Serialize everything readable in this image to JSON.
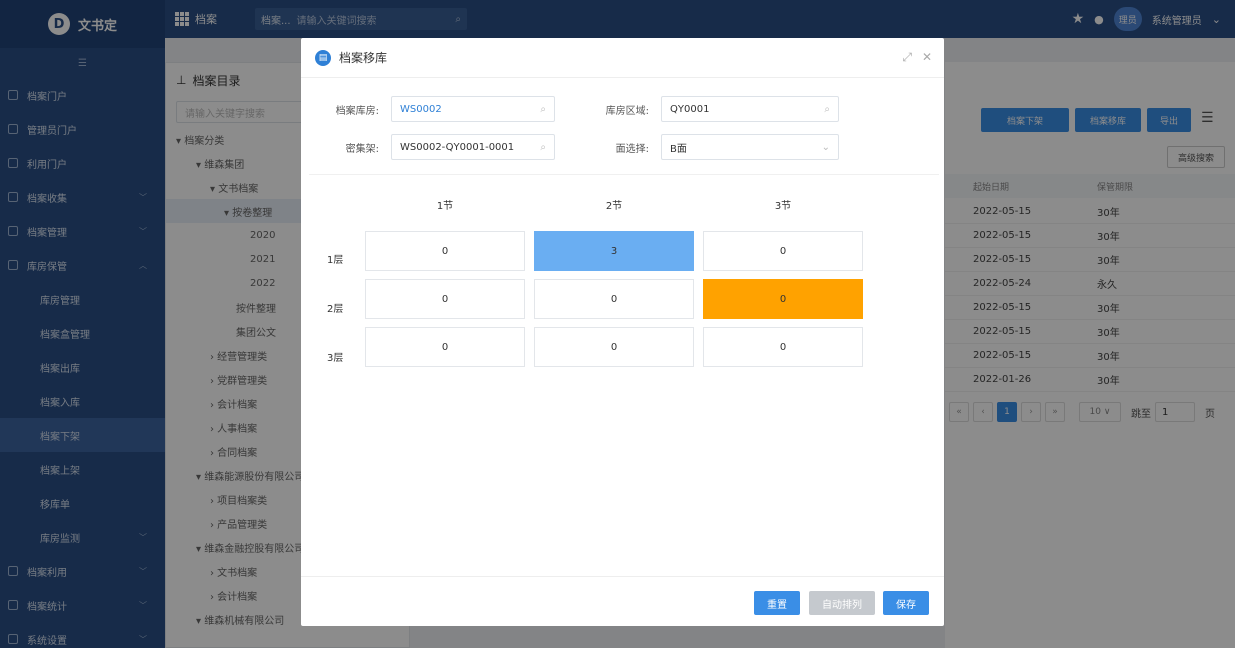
{
  "app": {
    "brand": "文书定",
    "colors": {
      "primary": "#2a4f86",
      "accent": "#3a8ee6",
      "cell_highlight_blue": "#6aaef2",
      "cell_highlight_orange": "#ffa200"
    }
  },
  "topbar": {
    "module": "档案",
    "search_scope": "档案...",
    "search_placeholder": "请输入关键词搜索",
    "username": "系统管理员",
    "avatar_text": "理员"
  },
  "sidebar": {
    "items": [
      {
        "label": "档案门户",
        "icon": "portal-icon",
        "indent": false,
        "chevron": ""
      },
      {
        "label": "管理员门户",
        "icon": "admin-portal-icon",
        "indent": false,
        "chevron": ""
      },
      {
        "label": "利用门户",
        "icon": "use-portal-icon",
        "indent": false,
        "chevron": ""
      },
      {
        "label": "档案收集",
        "icon": "collect-icon",
        "indent": false,
        "chevron": "﹀"
      },
      {
        "label": "档案管理",
        "icon": "manage-icon",
        "indent": false,
        "chevron": "﹀"
      },
      {
        "label": "库房保管",
        "icon": "storage-icon",
        "indent": false,
        "chevron": "︿"
      },
      {
        "label": "库房管理",
        "icon": "",
        "indent": true,
        "chevron": ""
      },
      {
        "label": "档案盒管理",
        "icon": "",
        "indent": true,
        "chevron": ""
      },
      {
        "label": "档案出库",
        "icon": "",
        "indent": true,
        "chevron": ""
      },
      {
        "label": "档案入库",
        "icon": "",
        "indent": true,
        "chevron": ""
      },
      {
        "label": "档案下架",
        "icon": "",
        "indent": true,
        "chevron": "",
        "active": true
      },
      {
        "label": "档案上架",
        "icon": "",
        "indent": true,
        "chevron": ""
      },
      {
        "label": "移库单",
        "icon": "",
        "indent": true,
        "chevron": ""
      },
      {
        "label": "库房监测",
        "icon": "",
        "indent": true,
        "chevron": "﹀"
      },
      {
        "label": "档案利用",
        "icon": "use-icon",
        "indent": false,
        "chevron": "﹀"
      },
      {
        "label": "档案统计",
        "icon": "stats-icon",
        "indent": false,
        "chevron": "﹀"
      },
      {
        "label": "系统设置",
        "icon": "settings-icon",
        "indent": false,
        "chevron": "﹀"
      }
    ]
  },
  "tree": {
    "title": "档案目录",
    "search_placeholder": "请输入关键字搜索",
    "nodes": [
      {
        "label": "▾ 档案分类",
        "indent": 10
      },
      {
        "label": "▾ 维森集团",
        "indent": 30
      },
      {
        "label": "▾ 文书档案",
        "indent": 44
      },
      {
        "label": "▾ 按卷整理",
        "indent": 58,
        "selected": true
      },
      {
        "label": "2020",
        "indent": 84
      },
      {
        "label": "2021",
        "indent": 84
      },
      {
        "label": "2022",
        "indent": 84
      },
      {
        "label": "按件整理",
        "indent": 70
      },
      {
        "label": "集团公文",
        "indent": 70
      },
      {
        "label": "› 经营管理类",
        "indent": 44
      },
      {
        "label": "› 党群管理类",
        "indent": 44
      },
      {
        "label": "› 会计档案",
        "indent": 44
      },
      {
        "label": "› 人事档案",
        "indent": 44
      },
      {
        "label": "› 合同档案",
        "indent": 44
      },
      {
        "label": "▾ 维森能源股份有限公司",
        "indent": 30
      },
      {
        "label": "› 项目档案类",
        "indent": 44
      },
      {
        "label": "› 产品管理类",
        "indent": 44
      },
      {
        "label": "▾ 维森金融控股有限公司",
        "indent": 30
      },
      {
        "label": "› 文书档案",
        "indent": 44
      },
      {
        "label": "› 会计档案",
        "indent": 44
      },
      {
        "label": "▾ 维森机械有限公司",
        "indent": 30
      }
    ]
  },
  "main": {
    "buttons": {
      "takedown": "档案下架",
      "move": "档案移库",
      "export": "导出",
      "advanced_search": "高级搜索"
    },
    "columns": [
      "起始日期",
      "保管期限"
    ],
    "rows": [
      {
        "date": "2022-05-15",
        "period": "30年"
      },
      {
        "date": "2022-05-15",
        "period": "30年"
      },
      {
        "date": "2022-05-15",
        "period": "30年"
      },
      {
        "date": "2022-05-24",
        "period": "永久"
      },
      {
        "date": "2022-05-15",
        "period": "30年"
      },
      {
        "date": "2022-05-15",
        "period": "30年"
      },
      {
        "date": "2022-05-15",
        "period": "30年"
      },
      {
        "date": "2022-01-26",
        "period": "30年"
      }
    ],
    "pager": {
      "current": "1",
      "page_size": "10 ∨",
      "goto_label": "跳至",
      "goto_value": "1",
      "page_suffix": "页"
    }
  },
  "dialog": {
    "title": "档案移库",
    "fields": {
      "warehouse": {
        "label": "档案库房:",
        "value": "WS0002"
      },
      "area": {
        "label": "库房区域:",
        "value": "QY0001"
      },
      "shelf": {
        "label": "密集架:",
        "value": "WS0002-QY0001-0001"
      },
      "side": {
        "label": "面选择:",
        "value": "B面"
      }
    },
    "grid": {
      "col_labels": [
        "1节",
        "2节",
        "3节"
      ],
      "row_labels": [
        "1层",
        "2层",
        "3层"
      ],
      "cells": [
        [
          {
            "value": "0",
            "state": "normal"
          },
          {
            "value": "3",
            "state": "occupied"
          },
          {
            "value": "0",
            "state": "normal"
          }
        ],
        [
          {
            "value": "0",
            "state": "normal"
          },
          {
            "value": "0",
            "state": "normal"
          },
          {
            "value": "0",
            "state": "selected"
          }
        ],
        [
          {
            "value": "0",
            "state": "normal"
          },
          {
            "value": "0",
            "state": "normal"
          },
          {
            "value": "0",
            "state": "normal"
          }
        ]
      ]
    },
    "buttons": {
      "reset": "重置",
      "auto_arrange": "自动排列",
      "save": "保存"
    }
  }
}
